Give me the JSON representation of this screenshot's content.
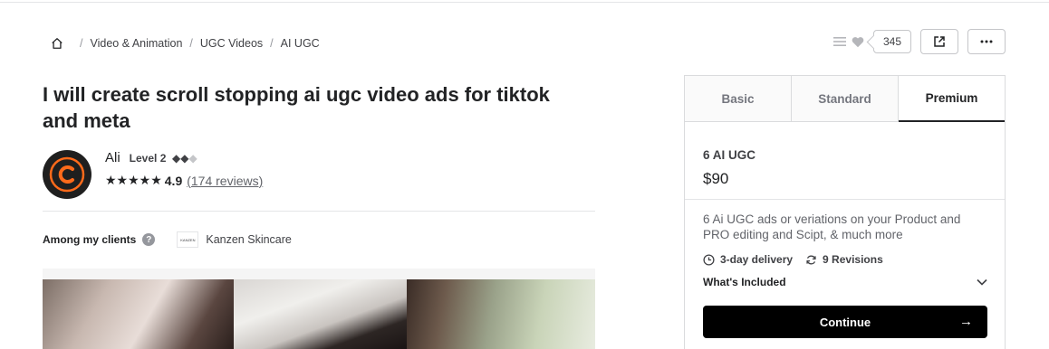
{
  "breadcrumb": {
    "items": [
      "Video & Animation",
      "UGC Videos",
      "AI UGC"
    ]
  },
  "actions": {
    "like_count": "345"
  },
  "gig": {
    "title": "I will create scroll stopping ai ugc video ads for tiktok and meta"
  },
  "seller": {
    "name": "Ali",
    "level": "Level 2",
    "rating": "4.9",
    "reviews": "(174 reviews)",
    "stars": "★★★★★"
  },
  "clients": {
    "label": "Among my clients",
    "help": "?",
    "client_name": "Kanzen Skincare",
    "client_logo_text": "KANZEN"
  },
  "package": {
    "tabs": [
      "Basic",
      "Standard",
      "Premium"
    ],
    "active_tab": "Premium",
    "name": "6 AI UGC",
    "price": "$90",
    "description": "6 Ai UGC ads or veriations on your Product and PRO editing and Scipt, & much more",
    "delivery": "3-day delivery",
    "revisions": "9 Revisions",
    "included_label": "What's Included",
    "continue_label": "Continue",
    "continue_arrow": "→"
  },
  "colors": {
    "brand_orange": "#ff6a1a",
    "text_dark": "#222325",
    "button_bg": "#000000"
  }
}
